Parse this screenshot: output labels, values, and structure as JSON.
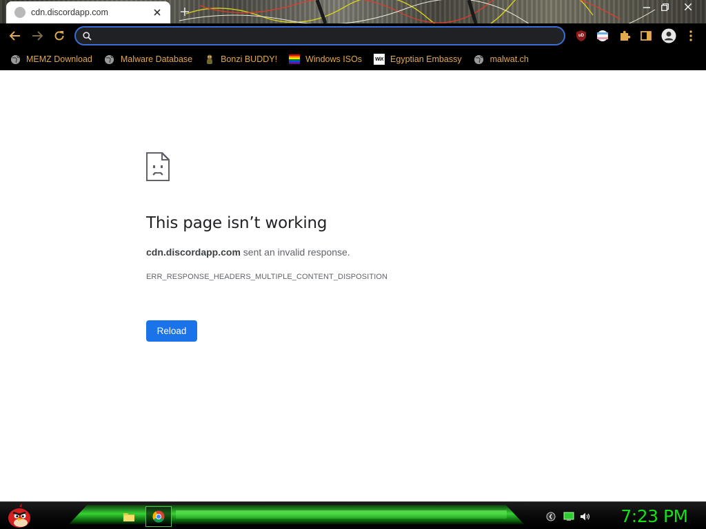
{
  "browser": {
    "tab_title": "cdn.discordapp.com",
    "omnibox_value": ""
  },
  "bookmarks": [
    {
      "label": "MEMZ Download",
      "icon": "globe-icon"
    },
    {
      "label": "Malware Database",
      "icon": "globe-icon"
    },
    {
      "label": "Bonzi BUDDY!",
      "icon": "bonzi-icon"
    },
    {
      "label": "Windows ISOs",
      "icon": "rainbow-flag-icon"
    },
    {
      "label": "Egyptian Embassy",
      "icon": "wix-icon",
      "icon_text": "WiX"
    },
    {
      "label": "malwat.ch",
      "icon": "globe-icon"
    }
  ],
  "error_page": {
    "title": "This page isn’t working",
    "host": "cdn.discordapp.com",
    "message": " sent an invalid response.",
    "code": "ERR_RESPONSE_HEADERS_MULTIPLE_CONTENT_DISPOSITION",
    "reload_label": "Reload"
  },
  "taskbar": {
    "clock": "7:23 PM"
  },
  "extensions": {
    "ublock_text": "uD"
  },
  "colors": {
    "accent": "#1a73e8",
    "bookmark_text": "#e3a94f",
    "clock": "#13e01a",
    "omnibox_border": "#3b6fd8",
    "nav_icons": "#e3a94f"
  }
}
